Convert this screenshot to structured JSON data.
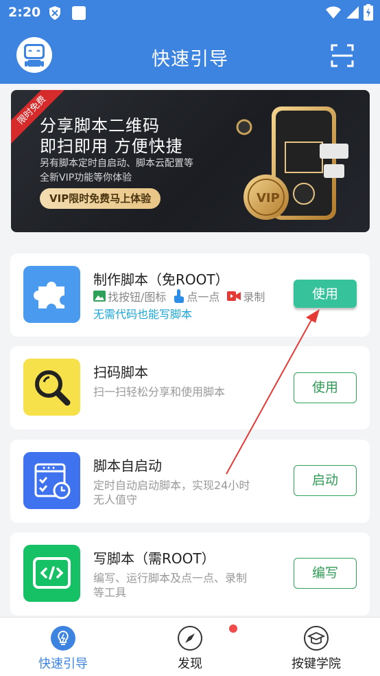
{
  "status_bar": {
    "time": "2:20"
  },
  "app_bar": {
    "title": "快速引导"
  },
  "banner": {
    "ribbon": "限时免费",
    "title": "分享脚本二维码",
    "subtitle": "即扫即用 方便快捷",
    "desc_line1": "另有脚本定时自启动、脚本云配置等",
    "desc_line2": "全新VIP功能等你体验",
    "cta": "VIP限时免费马上体验",
    "art_label": "VIP"
  },
  "cards": [
    {
      "title": "制作脚本（免ROOT）",
      "tags": [
        "找按钮/图标",
        "点一点",
        "录制"
      ],
      "highlight": "无需代码也能写脚本",
      "button": "使用",
      "icon_color": "#4a9bf0"
    },
    {
      "title": "扫码脚本",
      "desc_lines": [
        "扫一扫轻松分享和使用脚本"
      ],
      "button": "使用",
      "icon_color": "#f6e14b"
    },
    {
      "title": "脚本自启动",
      "desc_lines": [
        "定时自动启动脚本，实现24小时",
        "无人值守"
      ],
      "button": "启动",
      "icon_color": "#3f72ee"
    },
    {
      "title": "写脚本（需ROOT）",
      "desc_lines": [
        "编写、运行脚本及点一点、录制",
        "等工具"
      ],
      "button": "编写",
      "icon_color": "#16c166"
    }
  ],
  "bottom_nav": [
    {
      "label": "快速引导",
      "icon": "bulb-icon",
      "active": true
    },
    {
      "label": "发现",
      "icon": "compass-icon",
      "active": false,
      "has_badge": true
    },
    {
      "label": "按键学院",
      "icon": "graduation-cap-icon",
      "active": false
    }
  ],
  "colors": {
    "primary": "#3d83e0",
    "accent_green": "#36c29a",
    "outline_green": "#2f9a55",
    "highlight_blue": "#1aa6d6",
    "annotation_red": "#e53935"
  }
}
